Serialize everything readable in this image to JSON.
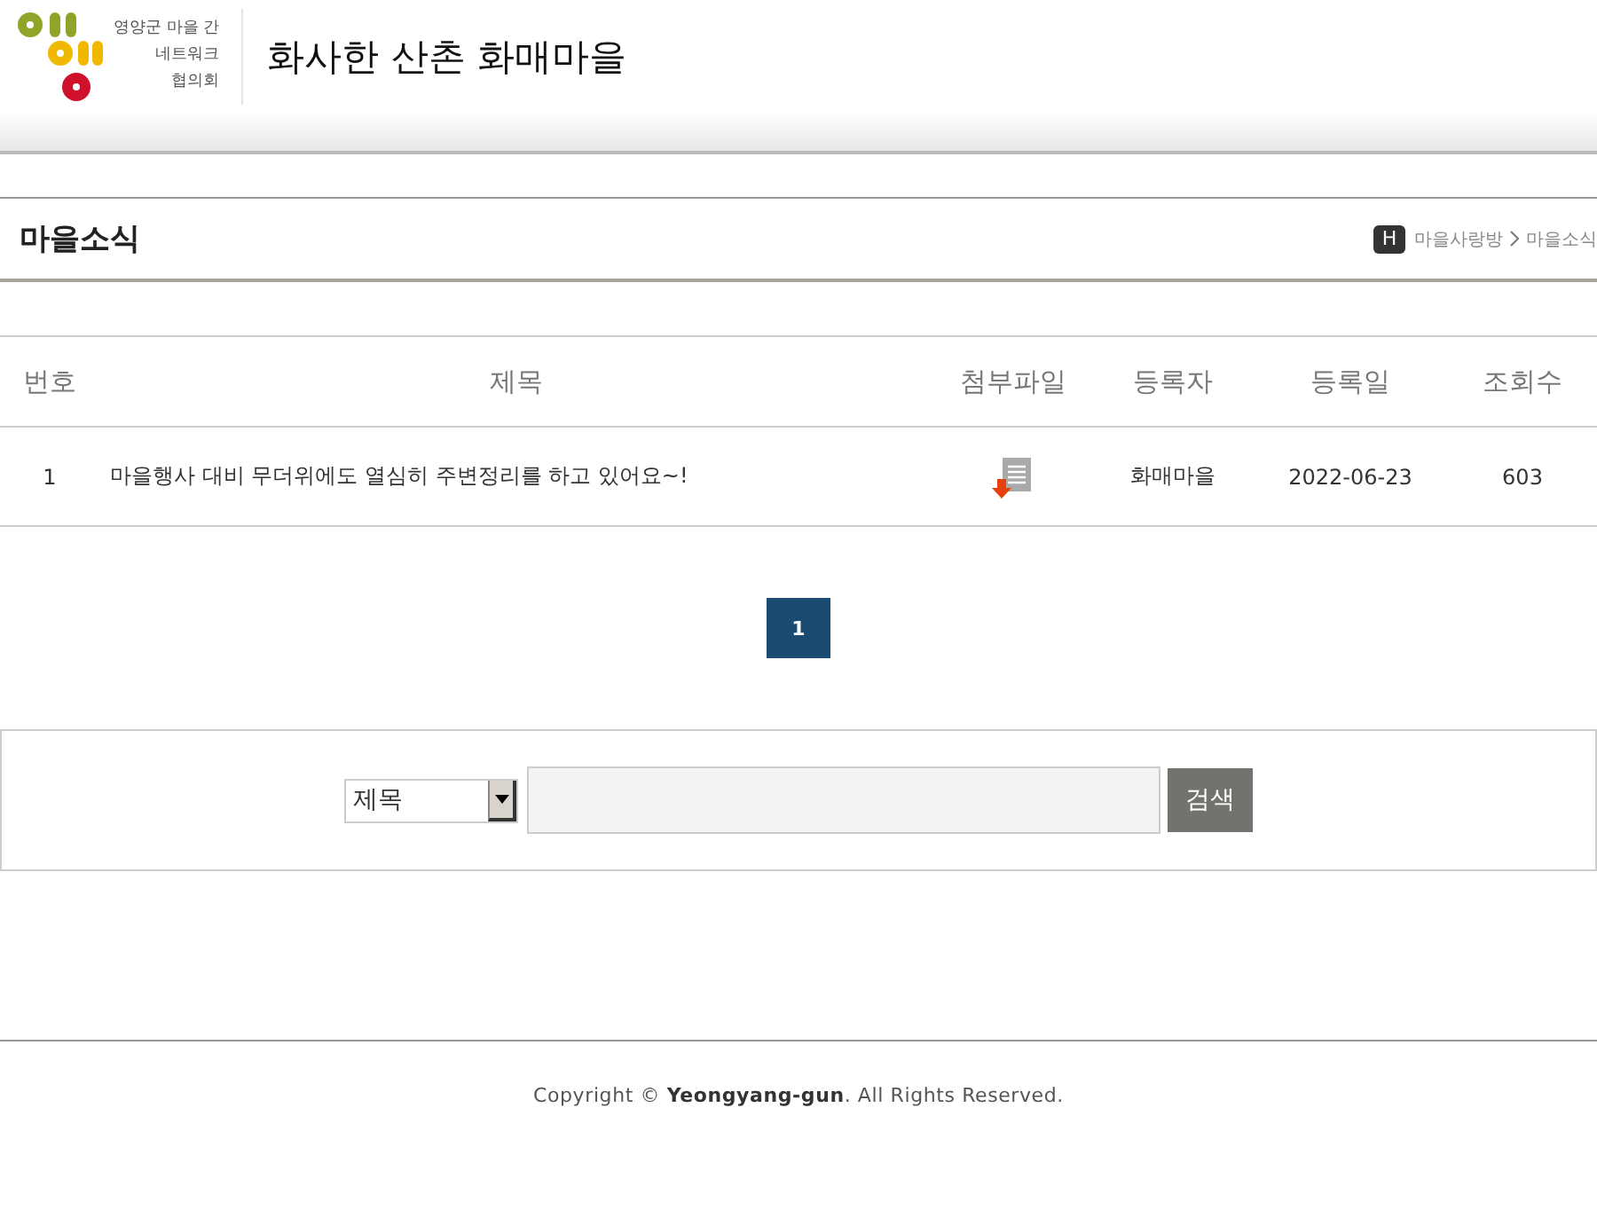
{
  "header": {
    "logo_lines": [
      "영양군 마을 간",
      "네트워크",
      "협의회"
    ],
    "site_title": "화사한 산촌 화매마을"
  },
  "page_title": "마을소식",
  "breadcrumb": {
    "home_badge": "H",
    "items": [
      "마을사랑방",
      "마을소식"
    ]
  },
  "table": {
    "columns": [
      "번호",
      "제목",
      "첨부파일",
      "등록자",
      "등록일",
      "조회수"
    ],
    "rows": [
      {
        "number": "1",
        "title": "마을행사 대비 무더위에도 열심히 주변정리를 하고 있어요~!",
        "has_attachment": true,
        "author": "화매마을",
        "date": "2022-06-23",
        "views": "603"
      }
    ]
  },
  "pagination": [
    {
      "label": "1",
      "selected": true
    }
  ],
  "search": {
    "field_select": "제목",
    "button": "검색"
  },
  "footer": {
    "copyright": "Copyright © **Yeongyang-gun**. All Rights Reserved."
  }
}
